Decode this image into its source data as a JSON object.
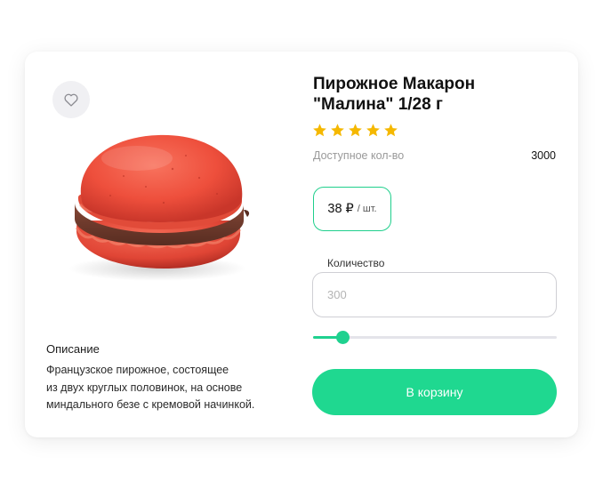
{
  "product": {
    "title_lines": [
      "Пирожное Макарон",
      "\"Малина\" 1/28 г"
    ],
    "rating": 5,
    "rating_max": 5,
    "favorite_icon": "heart-outline-icon",
    "image_icon": "raspberry-macaron-image"
  },
  "stock": {
    "label": "Доступное кол-во",
    "value": "3000"
  },
  "price": {
    "value": "38 ₽",
    "unit": "/ шт."
  },
  "quantity": {
    "label": "Количество",
    "placeholder": "300",
    "slider_fraction": 0.12
  },
  "cart_button": {
    "label": "В корзину"
  },
  "description": {
    "title": "Описание",
    "lines": [
      "Французское пирожное, состоящее",
      "из двух круглых половинок, на основе",
      "миндального безе с кремовой начинкой."
    ]
  },
  "colors": {
    "accent": "#1fd890",
    "star": "#f5b800",
    "border_accent": "#1fcf8c"
  }
}
